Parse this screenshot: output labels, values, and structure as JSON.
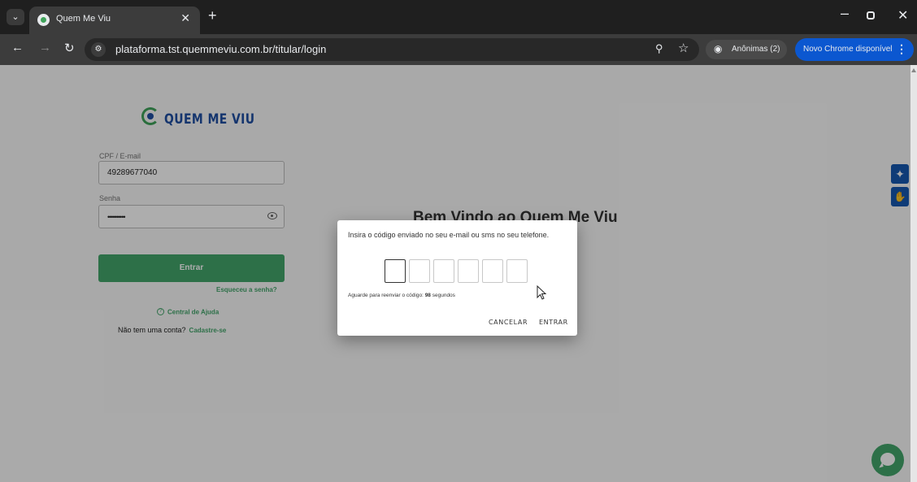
{
  "browser": {
    "tab_title": "Quem Me Viu",
    "url": "plataforma.tst.quemmeviu.com.br/titular/login",
    "incognito_label": "Anônimas (2)",
    "update_label": "Novo Chrome disponível",
    "icons": {
      "tab_search": "chevron-down-icon",
      "close_tab": "close-icon",
      "new_tab": "plus-icon",
      "back": "arrow-left-icon",
      "forward": "arrow-right-icon",
      "reload": "reload-icon",
      "site_info": "tune-icon",
      "zoom": "zoom-icon",
      "bookmark": "star-icon",
      "incognito": "incognito-icon",
      "menu": "kebab-icon"
    }
  },
  "login": {
    "logo_text": "QUEM ME VIU",
    "cpf_label": "CPF / E-mail",
    "cpf_value": "49289677040",
    "senha_label": "Senha",
    "senha_value": "••••••••••",
    "submit_label": "Entrar",
    "forgot_label": "Esqueceu a senha?",
    "help_label": "Central de Ajuda",
    "signup_question": "Não tem uma conta?",
    "signup_link": "Cadastre-se"
  },
  "welcome_title": "Bem Vindo ao Quem Me Viu",
  "dialog": {
    "message": "Insira o código enviado no seu e-mail ou sms no seu telefone.",
    "code_digits": [
      "",
      "",
      "",
      "",
      "",
      ""
    ],
    "resend_prefix": "Aguarde para reenviar o código:",
    "resend_seconds": "98",
    "resend_suffix": "segundos",
    "cancel_label": "CANCELAR",
    "enter_label": "ENTRAR"
  },
  "colors": {
    "brand_green": "#43a56b",
    "brand_blue": "#1f4fa3",
    "chrome_update_blue": "#0b57d0"
  }
}
